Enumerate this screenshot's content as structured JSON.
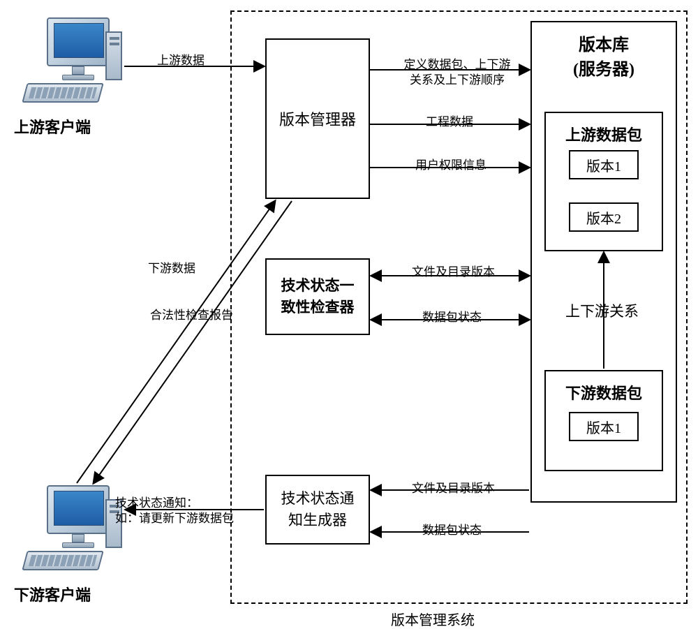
{
  "clients": {
    "upstream": "上游客户端",
    "downstream": "下游客户端"
  },
  "edges": {
    "upstream_data": "上游数据",
    "downstream_data": "下游数据",
    "legality_report": "合法性检查报告",
    "notification_prefix": "技术状态通知：",
    "notification_example": "如：请更新下游数据包",
    "define_packages_l1": "定义数据包、上下游",
    "define_packages_l2": "关系及上下游顺序",
    "engineering_data": "工程数据",
    "user_permissions": "用户权限信息",
    "file_dir_version": "文件及目录版本",
    "package_status": "数据包状态",
    "relation": "上下游关系"
  },
  "boxes": {
    "version_manager": "版本管理器",
    "consistency_checker_l1": "技术状态一",
    "consistency_checker_l2": "致性检查器",
    "notification_generator_l1": "技术状态通",
    "notification_generator_l2": "知生成器",
    "system_caption": "版本管理系统",
    "repository_title": "版本库",
    "repository_subtitle": "(服务器)",
    "upstream_package": "上游数据包",
    "downstream_package": "下游数据包",
    "version1": "版本1",
    "version2": "版本2"
  }
}
